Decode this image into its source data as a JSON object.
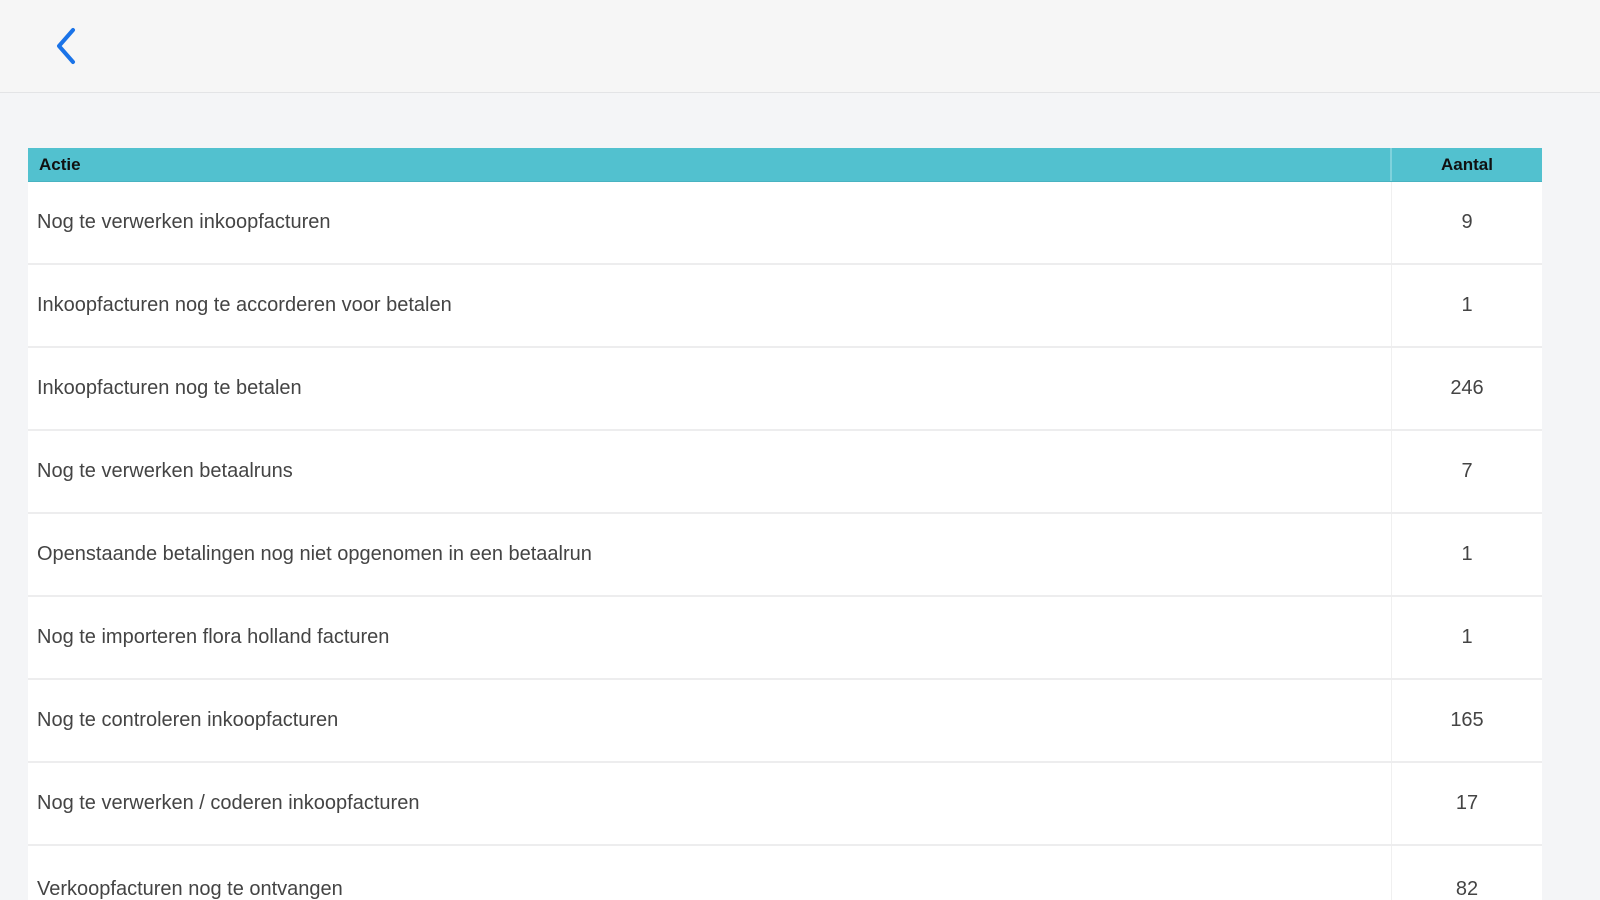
{
  "header": {
    "back_icon": "chevron-left-icon",
    "accent_color": "#1a73e8"
  },
  "table": {
    "header_color": "#52c1cf",
    "columns": [
      "Actie",
      "Aantal"
    ],
    "rows": [
      {
        "actie": "Nog te verwerken inkoopfacturen",
        "aantal": "9"
      },
      {
        "actie": "Inkoopfacturen nog te accorderen voor betalen",
        "aantal": "1"
      },
      {
        "actie": "Inkoopfacturen nog te betalen",
        "aantal": "246"
      },
      {
        "actie": "Nog te verwerken betaalruns",
        "aantal": "7"
      },
      {
        "actie": "Openstaande betalingen nog niet opgenomen in een betaalrun",
        "aantal": "1"
      },
      {
        "actie": "Nog te importeren flora holland facturen",
        "aantal": "1"
      },
      {
        "actie": "Nog te controleren inkoopfacturen",
        "aantal": "165"
      },
      {
        "actie": "Nog te verwerken / coderen inkoopfacturen",
        "aantal": "17"
      },
      {
        "actie": "Verkoopfacturen nog te ontvangen",
        "aantal": "82"
      }
    ]
  }
}
